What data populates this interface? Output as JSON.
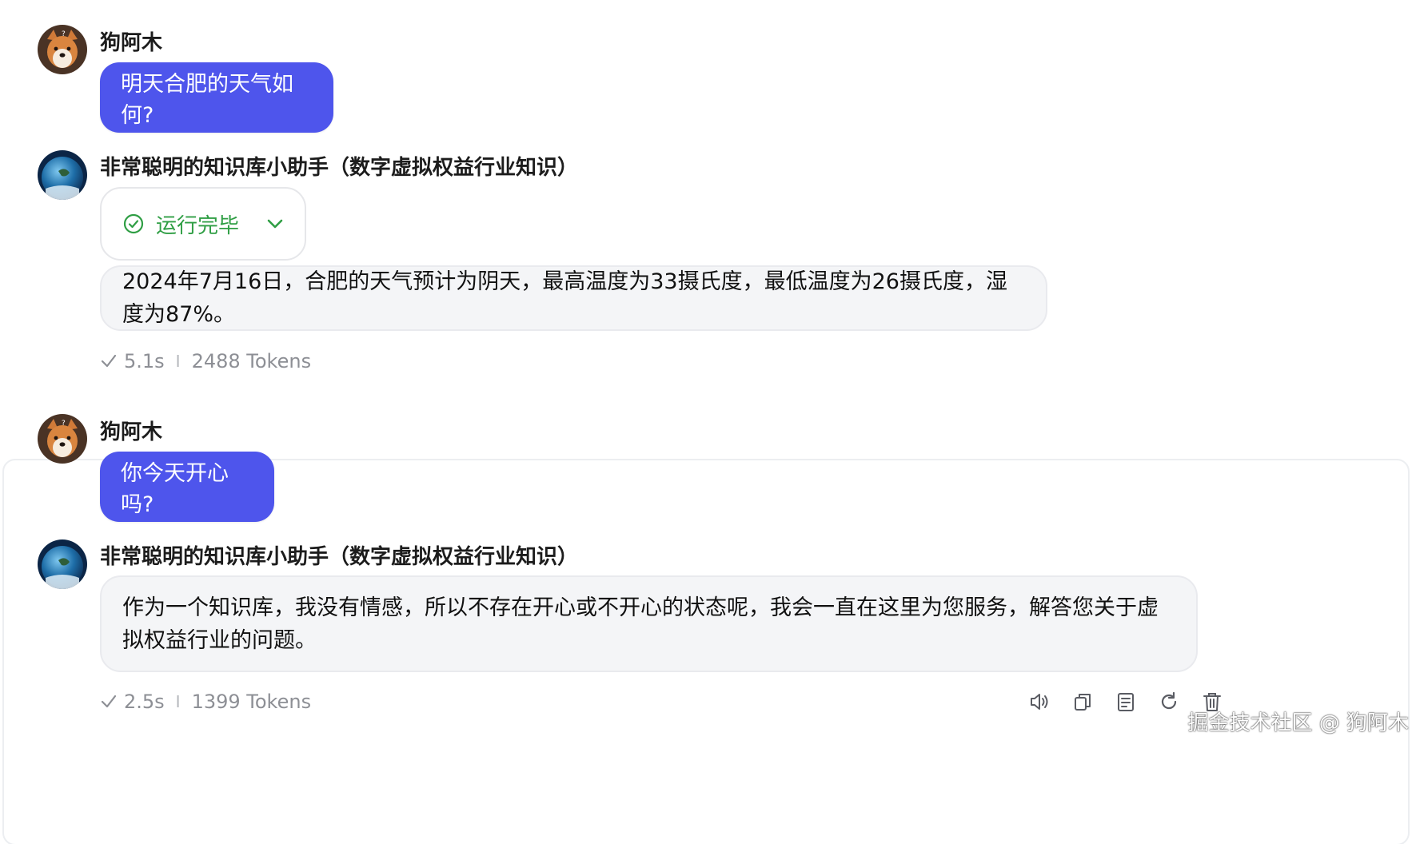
{
  "conversation": [
    {
      "user": {
        "name": "狗阿木",
        "message": "明天合肥的天气如何?"
      },
      "assistant": {
        "name": "非常聪明的知识库小助手（数字虚拟权益行业知识）",
        "status": "运行完毕",
        "answer": "2024年7月16日，合肥的天气预计为阴天，最高温度为33摄氏度，最低温度为26摄氏度，湿度为87%。",
        "time": "5.1s",
        "tokens": "2488 Tokens"
      }
    },
    {
      "user": {
        "name": "狗阿木",
        "message": "你今天开心吗?"
      },
      "assistant": {
        "name": "非常聪明的知识库小助手（数字虚拟权益行业知识）",
        "answer": "作为一个知识库，我没有情感，所以不存在开心或不开心的状态呢，我会一直在这里为您服务，解答您关于虚拟权益行业的问题。",
        "time": "2.5s",
        "tokens": "1399 Tokens"
      }
    }
  ],
  "separator": "I",
  "toolbar_icons": [
    "speaker-icon",
    "copy-icon",
    "notes-icon",
    "refresh-icon",
    "trash-icon"
  ],
  "watermark": "掘金技术社区 @ 狗阿木",
  "colors": {
    "user_bubble": "#4e55ec",
    "status_green": "#2f9e44",
    "answer_bg": "#f4f5f7",
    "meta_gray": "#8d8f95"
  }
}
